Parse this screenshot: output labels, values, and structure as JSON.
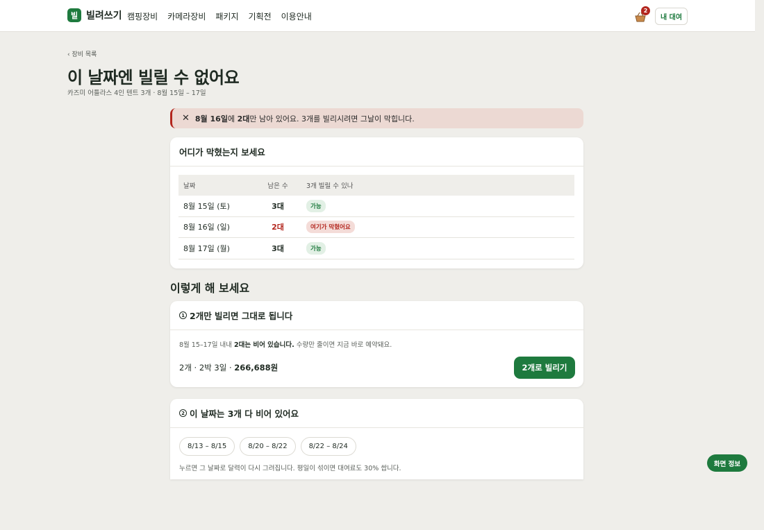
{
  "header": {
    "logo_mark": "빌",
    "logo_text": "빌려쓰기",
    "nav": [
      "캠핑장비",
      "카메라장비",
      "패키지",
      "기획전",
      "이용안내"
    ],
    "cart_count": "2",
    "my_rental_label": "내 대여"
  },
  "page": {
    "back_label": "‹ 장비 목록",
    "title": "이 날짜엔 빌릴 수 없어요",
    "subtitle": "카즈미 어틀라스 4인 텐트 3개 · 8월 15일 – 17일"
  },
  "alert": {
    "date": "8월 16일",
    "text_1": "에 ",
    "count": "2대",
    "text_2": "만 남아 있어요. 3개를 빌리시려면 그날이 막힙니다."
  },
  "availability": {
    "heading": "어디가 막혔는지 보세요",
    "columns": [
      "날짜",
      "남은 수",
      "3개 빌릴 수 있나"
    ],
    "rows": [
      {
        "date": "8월 15일 (토)",
        "remaining": "3대",
        "status": "가능"
      },
      {
        "date": "8월 16일 (일)",
        "remaining": "2대",
        "status": "여기가 막혔어요"
      },
      {
        "date": "8월 17일 (월)",
        "remaining": "3대",
        "status": "가능"
      }
    ]
  },
  "suggestions": {
    "section_title": "이렇게 해 보세요",
    "option1": {
      "num": "1",
      "heading": "2개만 빌리면 그대로 됩니다",
      "desc_1": "8월 15–17일 내내 ",
      "desc_bold": "2대는 비어 있습니다.",
      "desc_2": " 수량만 줄이면 지금 바로 예약돼요.",
      "price_prefix": "2개 · 2박 3일 · ",
      "price": "266,688원",
      "button": "2개로 빌리기"
    },
    "option2": {
      "num": "2",
      "heading": "이 날짜는 3개 다 비어 있어요",
      "chips": [
        "8/13 – 8/15",
        "8/20 – 8/22",
        "8/22 – 8/24"
      ],
      "desc": "누르면 그 날짜로 달력이 다시 그려집니다. 평일이 섞이면 대여료도 30% 쌉니다."
    }
  },
  "floating": {
    "info_button": "화면 정보"
  },
  "colors": {
    "brand": "#1e7a3e",
    "danger": "#b3261e",
    "background": "#efeeea"
  }
}
